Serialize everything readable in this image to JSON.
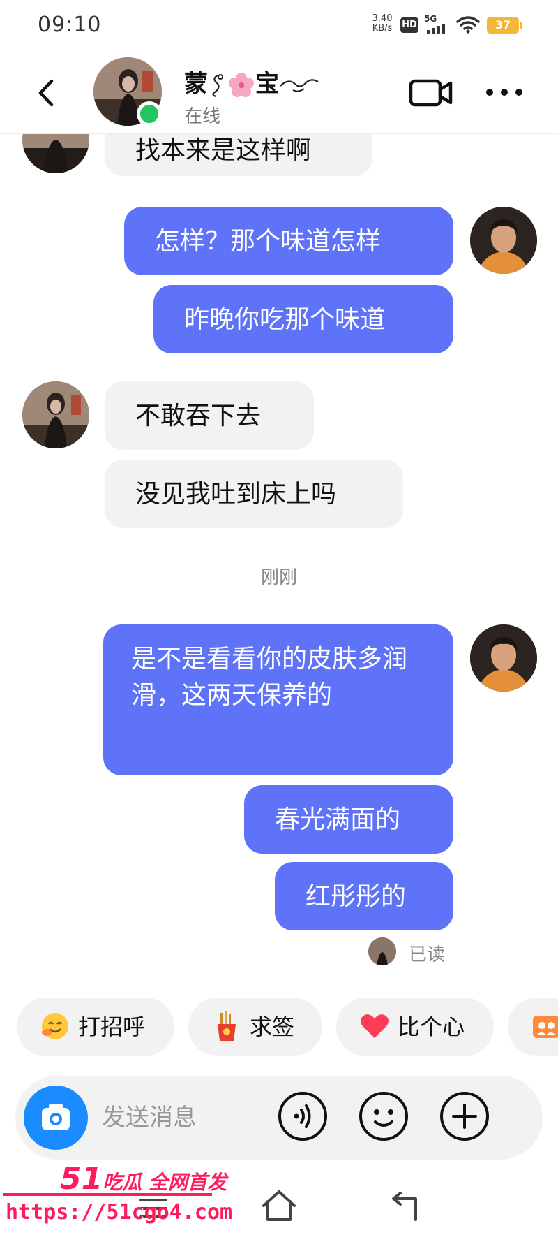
{
  "status_bar": {
    "time": "09:10",
    "net_speed_value": "3.40",
    "net_speed_unit": "KB/s",
    "hd": "HD",
    "network": "5G",
    "battery": "37",
    "battery_color": "#f3b83a"
  },
  "header": {
    "name_part1": "蒙",
    "name_part2": "宝",
    "status": "在线",
    "online_color": "#22c55e",
    "back_icon": "chevron-left-icon",
    "video_icon": "video-camera-icon",
    "more_icon": "more-dots-icon"
  },
  "messages": {
    "m0": "找本来是这样啊",
    "m1": "怎样？那个味道怎样",
    "m2": "昨晚你吃那个味道",
    "m3": "不敢吞下去",
    "m4": "没见我吐到床上吗",
    "timestamp": "刚刚",
    "m5": "是不是看看你的皮肤多润滑，这两天保养的",
    "m6": "春光满面的",
    "m7": "红彤彤的",
    "outgoing_color": "#5f73f9",
    "incoming_color": "#f2f2f2"
  },
  "read_receipt": {
    "text": "已读"
  },
  "quick_replies": {
    "items": [
      {
        "label": "打招呼",
        "icon": "wave-emoji-icon"
      },
      {
        "label": "求签",
        "icon": "fortune-sticks-icon"
      },
      {
        "label": "比个心",
        "icon": "heart-icon"
      },
      {
        "label": "",
        "icon": "group-photo-icon"
      }
    ]
  },
  "composer": {
    "placeholder": "发送消息",
    "camera_icon": "camera-icon",
    "voice_icon": "voice-icon",
    "emoji_icon": "emoji-icon",
    "plus_icon": "plus-icon",
    "camera_color": "#1a8cff"
  },
  "watermark": {
    "number": "51",
    "text": "吃瓜 全网首发",
    "url": "https://51cgo4.com",
    "color": "#ff1a5c"
  }
}
